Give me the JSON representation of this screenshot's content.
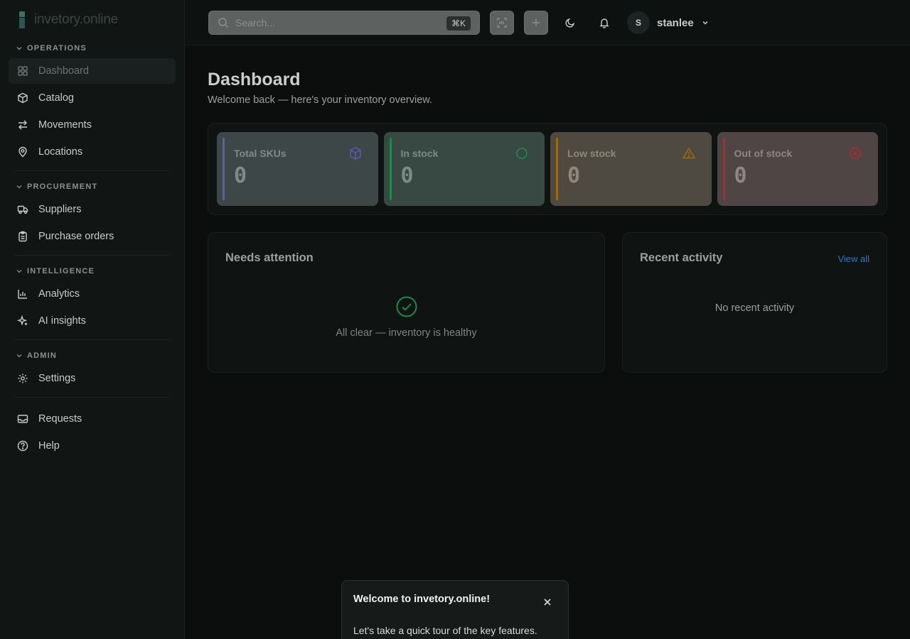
{
  "brand": {
    "name": "invetory.online"
  },
  "sidebar": {
    "sections": [
      {
        "label": "OPERATIONS",
        "items": [
          "Dashboard",
          "Catalog",
          "Movements",
          "Locations"
        ]
      },
      {
        "label": "PROCUREMENT",
        "items": [
          "Suppliers",
          "Purchase orders"
        ]
      },
      {
        "label": "INTELLIGENCE",
        "items": [
          "Analytics",
          "AI insights"
        ]
      },
      {
        "label": "ADMIN",
        "items": [
          "Settings"
        ]
      }
    ],
    "footer_items": [
      "Requests",
      "Help"
    ],
    "active_item": "Dashboard"
  },
  "header": {
    "search_placeholder": "Search...",
    "search_shortcut": "⌘K",
    "user": {
      "initial": "S",
      "name": "stanlee"
    }
  },
  "page": {
    "title": "Dashboard",
    "subtitle": "Welcome back — here's your inventory overview."
  },
  "stats": [
    {
      "label": "Total SKUs",
      "value": "0",
      "icon": "package-icon",
      "accent": "#5d5bb4"
    },
    {
      "label": "In stock",
      "value": "0",
      "icon": "circle-icon",
      "accent": "#1f8a4a"
    },
    {
      "label": "Low stock",
      "value": "0",
      "icon": "warning-icon",
      "accent": "#9a6a16"
    },
    {
      "label": "Out of stock",
      "value": "0",
      "icon": "x-circle-icon",
      "accent": "#b4282c"
    }
  ],
  "needs_attention": {
    "title": "Needs attention",
    "message": "All clear — inventory is healthy"
  },
  "recent_activity": {
    "title": "Recent activity",
    "view_all": "View all",
    "empty": "No recent activity"
  },
  "tour": {
    "title": "Welcome to invetory.online!",
    "body": "Let's take a quick tour of the key features."
  },
  "colors": {
    "link": "#3c73b8",
    "success": "#1f8a4a"
  }
}
